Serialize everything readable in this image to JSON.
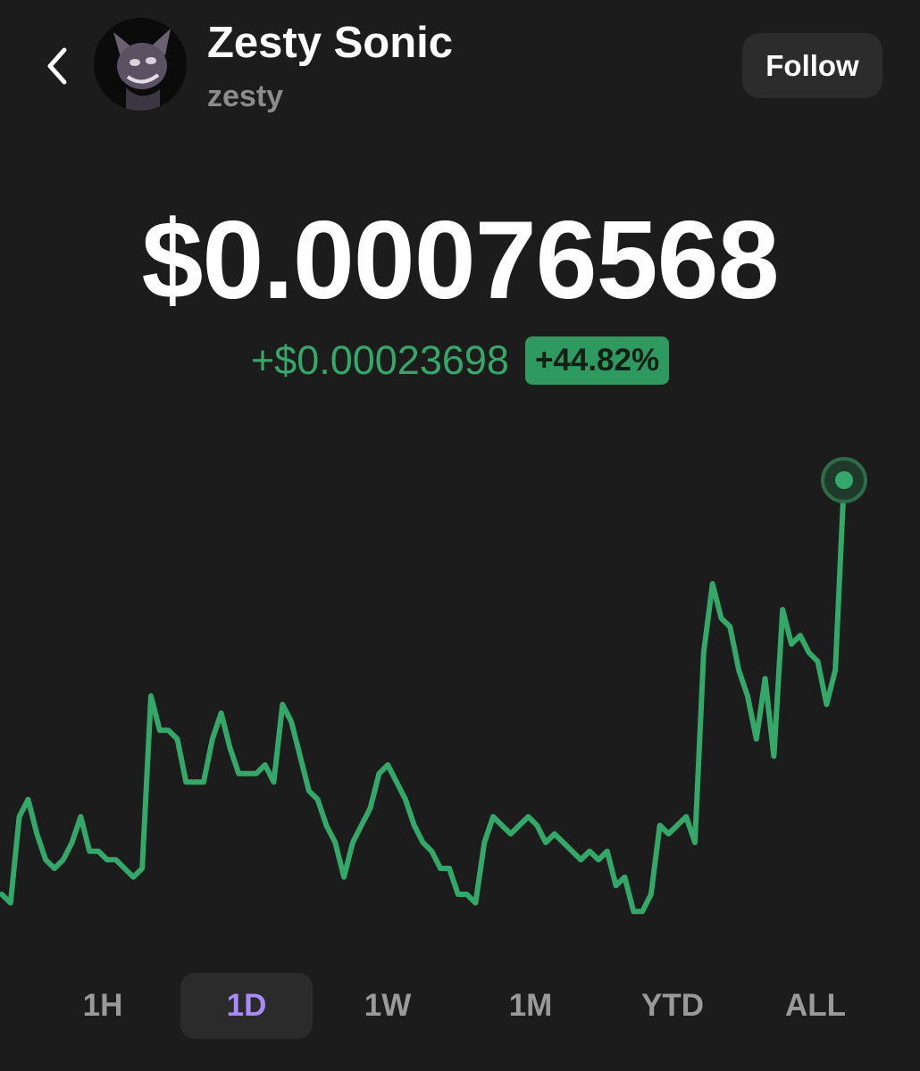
{
  "header": {
    "back_icon": "chevron-left-icon",
    "avatar_icon": "token-avatar-image",
    "name": "Zesty Sonic",
    "handle": "zesty",
    "follow_label": "Follow"
  },
  "price": {
    "current": "$0.00076568",
    "change_abs": "+$0.00023698",
    "change_pct": "+44.82%"
  },
  "colors": {
    "background": "#1c1c1c",
    "positive": "#34a868",
    "active_tab": "#a78bfa"
  },
  "ranges": {
    "active": "1D",
    "tabs": [
      "1H",
      "1D",
      "1W",
      "1M",
      "YTD",
      "ALL"
    ]
  },
  "chart_data": {
    "type": "line",
    "title": "",
    "xlabel": "",
    "ylabel": "",
    "ylim": [
      0.0005,
      0.0008
    ],
    "series": [
      {
        "values": [
          0.00053,
          0.000525,
          0.000575,
          0.000585,
          0.000565,
          0.00055,
          0.000545,
          0.00055,
          0.00056,
          0.000575,
          0.000555,
          0.000555,
          0.00055,
          0.00055,
          0.000545,
          0.00054,
          0.000545,
          0.000645,
          0.000625,
          0.000625,
          0.00062,
          0.000595,
          0.000595,
          0.000595,
          0.00062,
          0.000635,
          0.000615,
          0.0006,
          0.0006,
          0.0006,
          0.000605,
          0.000595,
          0.00064,
          0.00063,
          0.00061,
          0.00059,
          0.000585,
          0.00057,
          0.00056,
          0.00054,
          0.00056,
          0.00057,
          0.00058,
          0.0006,
          0.000605,
          0.000595,
          0.000585,
          0.00057,
          0.00056,
          0.000555,
          0.000545,
          0.000545,
          0.00053,
          0.00053,
          0.000525,
          0.00056,
          0.000575,
          0.00057,
          0.000565,
          0.00057,
          0.000575,
          0.00057,
          0.00056,
          0.000565,
          0.00056,
          0.000555,
          0.00055,
          0.000555,
          0.00055,
          0.000555,
          0.000535,
          0.00054,
          0.00052,
          0.00052,
          0.00053,
          0.00057,
          0.000565,
          0.00057,
          0.000575,
          0.00056,
          0.00067,
          0.00071,
          0.00069,
          0.000685,
          0.00066,
          0.000645,
          0.00062,
          0.000655,
          0.00061,
          0.000695,
          0.000675,
          0.00068,
          0.00067,
          0.000665,
          0.00064,
          0.00066,
          0.00077
        ]
      }
    ]
  }
}
